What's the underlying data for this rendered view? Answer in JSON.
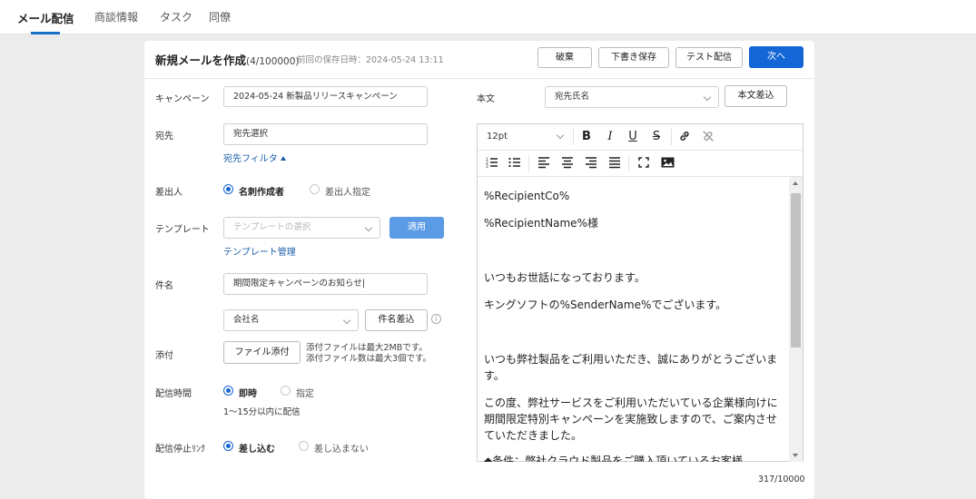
{
  "nav": {
    "tabs": [
      {
        "label": "メール配信",
        "active": true
      },
      {
        "label": "商談情報",
        "active": false
      },
      {
        "label": "タスク",
        "active": false
      },
      {
        "label": "同僚",
        "active": false
      }
    ]
  },
  "header": {
    "title": "新規メールを作成",
    "count": "(4/100000)",
    "saved": "前回の保存日時：2024-05-24 13:11",
    "buttons": {
      "discard": "破棄",
      "save_draft": "下書き保存",
      "test_send": "テスト配信",
      "next": "次へ"
    }
  },
  "form": {
    "campaign": {
      "label": "キャンペーン",
      "value": "2024-05-24 新製品リリースキャンペーン"
    },
    "recipient": {
      "label": "宛先",
      "value": "宛先選択",
      "filter_link": "宛先フィルタ"
    },
    "sender": {
      "label": "差出人",
      "options": [
        "名刺作成者",
        "差出人指定"
      ],
      "selected": 0
    },
    "template": {
      "label": "テンプレート",
      "placeholder": "テンプレートの選択",
      "apply": "適用",
      "manage_link": "テンプレート管理"
    },
    "subject": {
      "label": "件名",
      "value": "期間限定キャンペーンのお知らせ|",
      "insert_select": "会社名",
      "insert_button": "件名差込"
    },
    "attachment": {
      "label": "添付",
      "button": "ファイル添付",
      "note1": "添付ファイルは最大2MBです。",
      "note2": "添付ファイル数は最大3個です。"
    },
    "delivery_time": {
      "label": "配信時間",
      "options": [
        "即時",
        "指定"
      ],
      "selected": 0,
      "note": "1〜15分以内に配信"
    },
    "stop_delivery": {
      "label": "配信停止ﾘﾝｸ",
      "options": [
        "差し込む",
        "差し込まない"
      ],
      "selected": 0
    }
  },
  "body": {
    "label": "本文",
    "insert_select": "宛先氏名",
    "insert_button": "本文差込",
    "font_size": "12pt",
    "lines": [
      "%RecipientCo%",
      "%RecipientName%様",
      "いつもお世話になっております。",
      "キングソフトの%SenderName%でございます。",
      "いつも弊社製品をご利用いただき、誠にありがとうございま",
      "す。",
      "この度、弊社サービスをご利用いただいている企業様向けに",
      "期間限定特別キャンペーンを実施致しますので、ご案内させ",
      "ていただきました。",
      "◆条件：弊社クラウド製品をご購入頂いているお客様"
    ],
    "char_count": "317/10000"
  }
}
